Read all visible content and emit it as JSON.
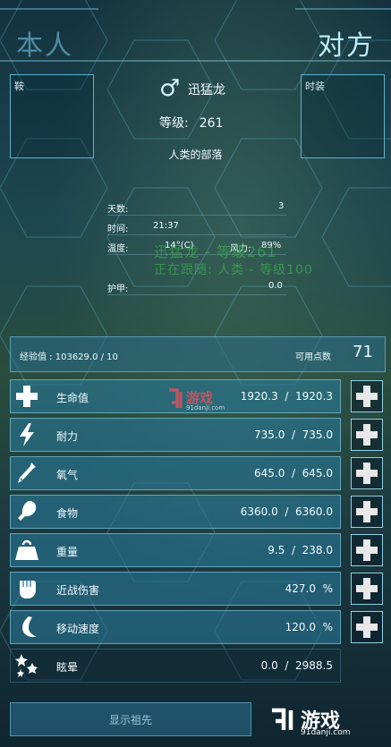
{
  "tabs": {
    "self": "本人",
    "other": "对方"
  },
  "slots": {
    "saddle": "鞍",
    "costume": "时装"
  },
  "creature": {
    "gender_symbol": "♂",
    "name": "迅猛龙",
    "level_label": "等级:",
    "level_value": "261",
    "tribe": "人类的部落"
  },
  "info": [
    {
      "label": "天数:",
      "value": "3"
    },
    {
      "label": "时间:",
      "value": "21:37"
    },
    {
      "label": "温度:",
      "value": "14°(C)",
      "label2": "风力:",
      "value2": "89%"
    },
    {
      "label": "护甲:",
      "value": "0.0"
    }
  ],
  "ghost": {
    "line1": "迅猛龙 - 等级261",
    "line2": "正在跟随: 人类 - 等级100"
  },
  "xp": {
    "label": "经验值 : 103629.0 / 10",
    "points_label": "可用点数",
    "points_value": "71"
  },
  "stats": [
    {
      "label": "生命值",
      "value": "1920.3  /  1920.3",
      "icon": "health-cross-icon"
    },
    {
      "label": "耐力",
      "value": "735.0  /  735.0",
      "icon": "lightning-icon"
    },
    {
      "label": "氧气",
      "value": "645.0  /  645.0",
      "icon": "oxygen-tank-icon"
    },
    {
      "label": "食物",
      "value": "6360.0  /  6360.0",
      "icon": "food-drumstick-icon"
    },
    {
      "label": "重量",
      "value": "9.5  /  238.0",
      "icon": "weight-icon"
    },
    {
      "label": "近战伤害",
      "value": "427.0  %",
      "icon": "fist-icon"
    },
    {
      "label": "移动速度",
      "value": "120.0  %",
      "icon": "foot-icon"
    },
    {
      "label": "眩晕",
      "value": "0.0  /  2988.5",
      "icon": "stars-icon"
    }
  ],
  "ancestors_button": "显示祖先",
  "watermark": {
    "brand_text": "游戏",
    "brand_url": "91danji.com",
    "center_text": "游戏",
    "center_url": "91danji.com"
  },
  "colors": {
    "accent": "#5fb3cf",
    "row_bg": "#2a7896",
    "text": "#f1fbff"
  }
}
